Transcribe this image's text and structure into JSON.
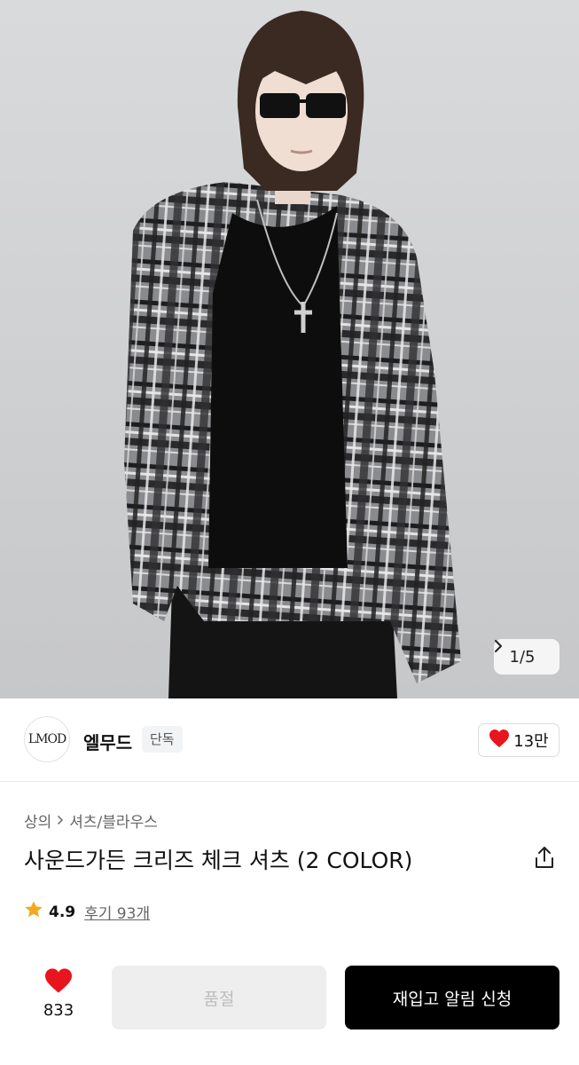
{
  "gallery": {
    "current": "1/5",
    "next_icon": "chevron-right-icon"
  },
  "brand": {
    "logo_text": "LMOD",
    "name": "엘무드",
    "badge": "단독",
    "likes": "13만",
    "like_icon": "heart-icon",
    "heart_color": "#e8141e"
  },
  "product": {
    "breadcrumb": [
      "상의",
      "셔츠/블라우스"
    ],
    "title": "사운드가든 크리즈 체크 셔츠 (2 COLOR)",
    "rating": "4.9",
    "reviews": "후기 93개",
    "star_color": "#f4a81d"
  },
  "bottom_bar": {
    "wish_count": "833",
    "soldout_label": "품절",
    "notify_label": "재입고 알림 신청"
  }
}
